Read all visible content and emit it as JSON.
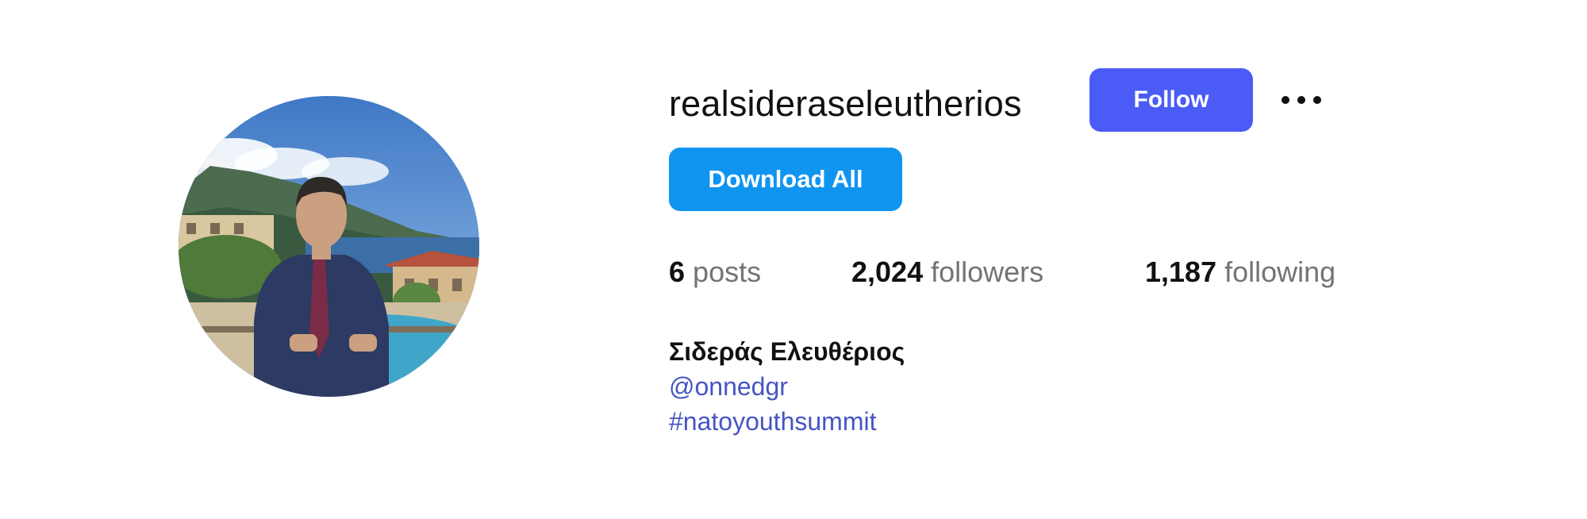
{
  "profile": {
    "username": "realsideraseleutherios",
    "full_name": "Σιδεράς Ελευθέριος",
    "avatar_icon": "profile-photo"
  },
  "actions": {
    "follow_label": "Follow",
    "more_icon": "more-options-icon",
    "download_label": "Download All"
  },
  "stats": {
    "posts_count": "6",
    "posts_label": "posts",
    "followers_count": "2,024",
    "followers_label": "followers",
    "following_count": "1,187",
    "following_label": "following"
  },
  "bio": {
    "mention": "@onnedgr",
    "hashtag": "#natoyouthsummit"
  },
  "colors": {
    "follow_button": "#4b5cf6",
    "download_button": "#0f95f0",
    "link": "#4655c3",
    "muted_text": "#737373"
  }
}
